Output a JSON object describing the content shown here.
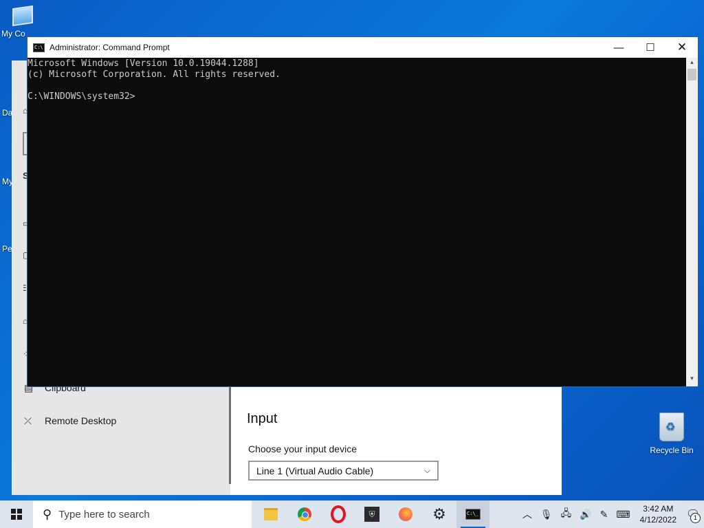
{
  "desktop": {
    "icons": [
      {
        "label": "My Co"
      },
      {
        "label": "Da"
      },
      {
        "label": "My"
      },
      {
        "label": "Pe"
      }
    ],
    "recycle_bin": {
      "label": "Recycle Bin",
      "icon": "recycle-bin-icon"
    }
  },
  "settings": {
    "sidebar": {
      "items": [
        {
          "label": "Clipboard",
          "icon": "clipboard-icon"
        },
        {
          "label": "Remote Desktop",
          "icon": "remote-desktop-icon"
        }
      ],
      "partial_header": "S"
    },
    "main": {
      "section_title": "Input",
      "input_label": "Choose your input device",
      "input_device_selected": "Line 1 (Virtual Audio Cable)"
    }
  },
  "cmd": {
    "title": "Administrator: Command Prompt",
    "console_lines": [
      "Microsoft Windows [Version 10.0.19044.1288]",
      "(c) Microsoft Corporation. All rights reserved.",
      "",
      "C:\\WINDOWS\\system32>"
    ],
    "controls": {
      "minimize": "—",
      "maximize": "☐",
      "close": "✕"
    }
  },
  "taskbar": {
    "search_placeholder": "Type here to search",
    "apps": [
      {
        "name": "File Explorer",
        "icon": "folder-icon"
      },
      {
        "name": "Google Chrome",
        "icon": "chrome-icon"
      },
      {
        "name": "Opera",
        "icon": "opera-icon"
      },
      {
        "name": "App",
        "icon": "shield-app-icon"
      },
      {
        "name": "Firefox",
        "icon": "firefox-icon"
      },
      {
        "name": "Settings",
        "icon": "gear-icon"
      },
      {
        "name": "Command Prompt",
        "icon": "cmd-icon",
        "active": true
      }
    ],
    "clock": {
      "time": "3:42 AM",
      "date": "4/12/2022"
    },
    "notification_count": "1"
  }
}
